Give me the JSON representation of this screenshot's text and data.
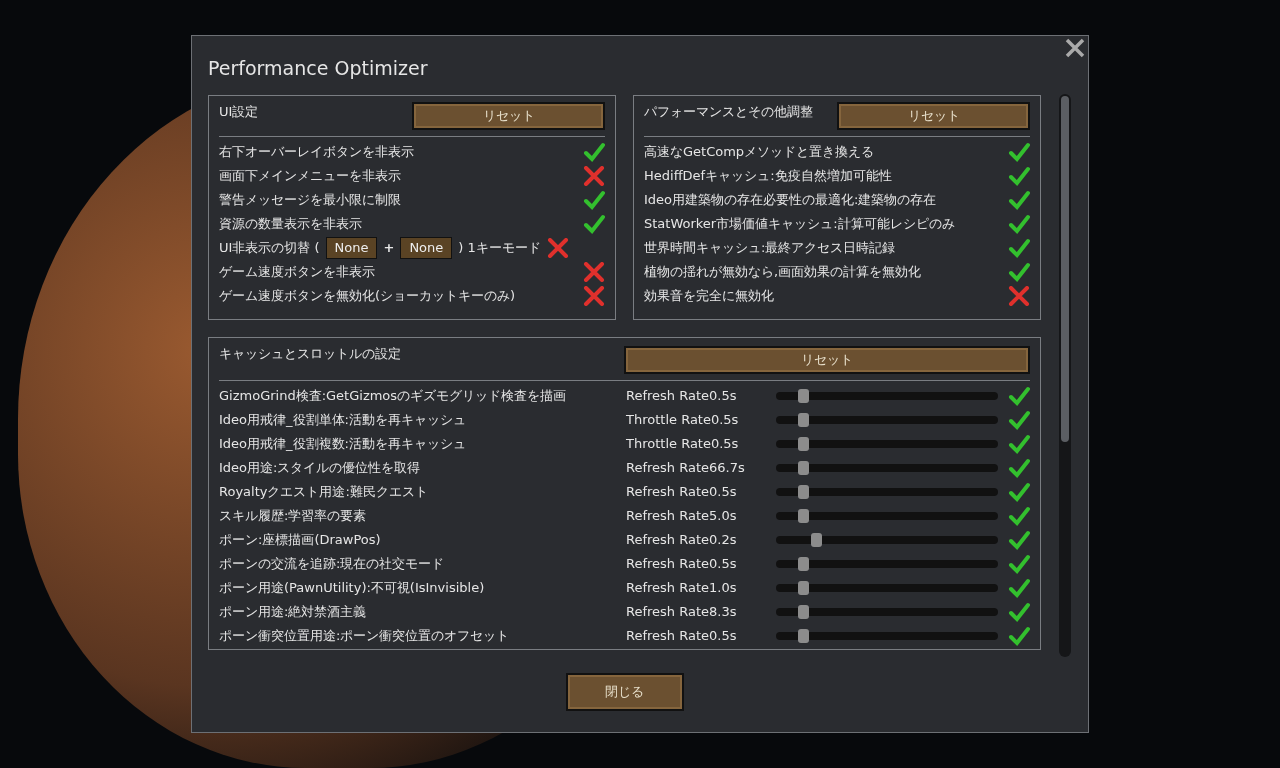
{
  "window": {
    "title": "Performance Optimizer"
  },
  "panels": [
    {
      "title": "UI設定",
      "reset": "リセット",
      "rows": [
        {
          "kind": "toggle",
          "label": "右下オーバーレイボタンを非表示",
          "checked": true
        },
        {
          "kind": "toggle",
          "label": "画面下メインメニューを非表示",
          "checked": false
        },
        {
          "kind": "toggle",
          "label": "警告メッセージを最小限に制限",
          "checked": true
        },
        {
          "kind": "toggle",
          "label": "資源の数量表示を非表示",
          "checked": true
        },
        {
          "kind": "hotkey",
          "label": "UI非表示の切替 (",
          "key1": "None",
          "plus": "+",
          "key2": "None",
          "suffix": ") 1キーモード",
          "checked": false
        },
        {
          "kind": "toggle",
          "label": "ゲーム速度ボタンを非表示",
          "checked": false
        },
        {
          "kind": "toggle",
          "label": "ゲーム速度ボタンを無効化(ショーカットキーのみ)",
          "checked": false
        }
      ]
    },
    {
      "title": "パフォーマンスとその他調整",
      "reset": "リセット",
      "rows": [
        {
          "kind": "toggle",
          "label": "高速なGetCompメソッドと置き換える",
          "checked": true
        },
        {
          "kind": "toggle",
          "label": "HediffDefキャッシュ:免疫自然増加可能性",
          "checked": true
        },
        {
          "kind": "toggle",
          "label": "Ideo用建築物の存在必要性の最適化:建築物の存在",
          "checked": true
        },
        {
          "kind": "toggle",
          "label": "StatWorker市場価値キャッシュ:計算可能レシピのみ",
          "checked": true
        },
        {
          "kind": "toggle",
          "label": "世界時間キャッシュ:最終アクセス日時記録",
          "checked": true
        },
        {
          "kind": "toggle",
          "label": "植物の揺れが無効なら,画面効果の計算を無効化",
          "checked": true
        },
        {
          "kind": "toggle",
          "label": "効果音を完全に無効化",
          "checked": false
        }
      ]
    }
  ],
  "cache": {
    "title": "キャッシュとスロットルの設定",
    "reset": "リセット",
    "rows": [
      {
        "label": "GizmoGrind検査:GetGizmosのギズモグリッド検査を描画",
        "rate": "Refresh Rate0.5s",
        "level": 0.12,
        "checked": true
      },
      {
        "label": "Ideo用戒律_役割単体:活動を再キャッシュ",
        "rate": "Throttle Rate0.5s",
        "level": 0.12,
        "checked": true
      },
      {
        "label": "Ideo用戒律_役割複数:活動を再キャッシュ",
        "rate": "Throttle Rate0.5s",
        "level": 0.12,
        "checked": true
      },
      {
        "label": "Ideo用途:スタイルの優位性を取得",
        "rate": "Refresh Rate66.7s",
        "level": 0.12,
        "checked": true
      },
      {
        "label": "Royaltyクエスト用途:難民クエスト",
        "rate": "Refresh Rate0.5s",
        "level": 0.12,
        "checked": true
      },
      {
        "label": "スキル履歴:学習率の要素",
        "rate": "Refresh Rate5.0s",
        "level": 0.12,
        "checked": true
      },
      {
        "label": "ポーン:座標描画(DrawPos)",
        "rate": "Refresh Rate0.2s",
        "level": 0.18,
        "checked": true
      },
      {
        "label": "ポーンの交流を追跡:現在の社交モード",
        "rate": "Refresh Rate0.5s",
        "level": 0.12,
        "checked": true
      },
      {
        "label": "ポーン用途(PawnUtility):不可視(IsInvisible)",
        "rate": "Refresh Rate1.0s",
        "level": 0.12,
        "checked": true
      },
      {
        "label": "ポーン用途:絶対禁酒主義",
        "rate": "Refresh Rate8.3s",
        "level": 0.12,
        "checked": true
      },
      {
        "label": "ポーン衝突位置用途:ポーン衝突位置のオフセット",
        "rate": "Refresh Rate0.5s",
        "level": 0.12,
        "checked": true
      }
    ]
  },
  "close_button": "閉じる"
}
